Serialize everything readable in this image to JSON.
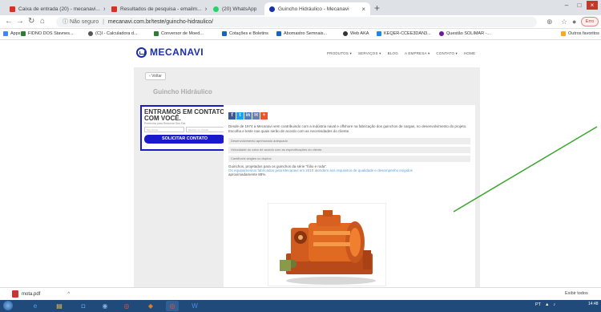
{
  "tabs": [
    {
      "label": "Caixa de entrada (20) - mecanavi...",
      "favicon": "gmail-icon",
      "color": "#d93025",
      "active": false
    },
    {
      "label": "Resultados de pesquisa - emailm...",
      "favicon": "gmail-icon",
      "color": "#d93025",
      "active": false
    },
    {
      "label": "(20) WhatsApp",
      "favicon": "whatsapp-icon",
      "color": "#25d366",
      "active": false
    },
    {
      "label": "Guincho Hidráulico - Mecanavi",
      "favicon": "mecanavi-icon",
      "color": "#1a2fa8",
      "active": true
    }
  ],
  "address": {
    "security": "Não seguro",
    "url": "mecanavi.com.br/teste/guincho-hidraulico/"
  },
  "user_button": "Erro",
  "bookmarks": [
    {
      "label": "Apps",
      "color": "#4285f4"
    },
    {
      "label": "FIDNO DOS Stavnes...",
      "color": "#2e7d32"
    },
    {
      "label": "(C)I - Calculadora d...",
      "color": "#555555"
    },
    {
      "label": "Conversor de Moed...",
      "color": "#2e7d32"
    },
    {
      "label": "Cotações e Boletins",
      "color": "#1565c0"
    },
    {
      "label": "Abomastro Semnais...",
      "color": "#1565c0"
    },
    {
      "label": "Web AKA",
      "color": "#333333"
    },
    {
      "label": "KEQER-CCEE3DAN3...",
      "color": "#1e88e5"
    },
    {
      "label": "Questão SOLIMAR -...",
      "color": "#6a1b9a"
    },
    {
      "label": "Outros favoritos",
      "color": "#f9a825"
    }
  ],
  "site": {
    "logo": "MECANAVI",
    "nav": [
      "PRODUTOS ▾",
      "SERVIÇOS ▾",
      "BLOG",
      "A EMPRESA ▾",
      "CONTATO ▾",
      "HOME"
    ],
    "back": "Voltar",
    "page_title": "Guincho Hidráulico"
  },
  "contact": {
    "heading": "ENTRAMOS EM CONTATO COM VOCÊ.",
    "sub": "Preencha para Ressrvar Seu Dia",
    "field_name": "Seu Nome",
    "field_phone": "Telefone ou Celular",
    "button": "SOLICITAR CONTATO"
  },
  "article": {
    "intro": "Desde de 1974 a Mecanavi vem contribuindo com a indústria naval e offshore na fabricação dos guinchos de cargas, no desenvolvimento do projeto. Escolha e teste nas quais serão de acordo com as necessidades do cliente.",
    "bullets": [
      "Desenvolvimento aprimorado adequado",
      "Velocidade do cabo de acordo com as especificações do cliente.",
      "Cantilíveis singles ou duplos"
    ],
    "extra_1": "Guinchos, projetados para os guinchos da série \"fólio e roda\".",
    "extra_2": "Os equipamentos fabricados pela Mecanavi em 2010 atendem aos requisitos de qualidade e desempenho exigidos",
    "extra_3": "aproximadamente 88%."
  },
  "downloads": {
    "file": "mota.pdf",
    "show_all": "Exibir todos"
  },
  "taskbar": {
    "tray": "PT",
    "time": "14:48"
  }
}
